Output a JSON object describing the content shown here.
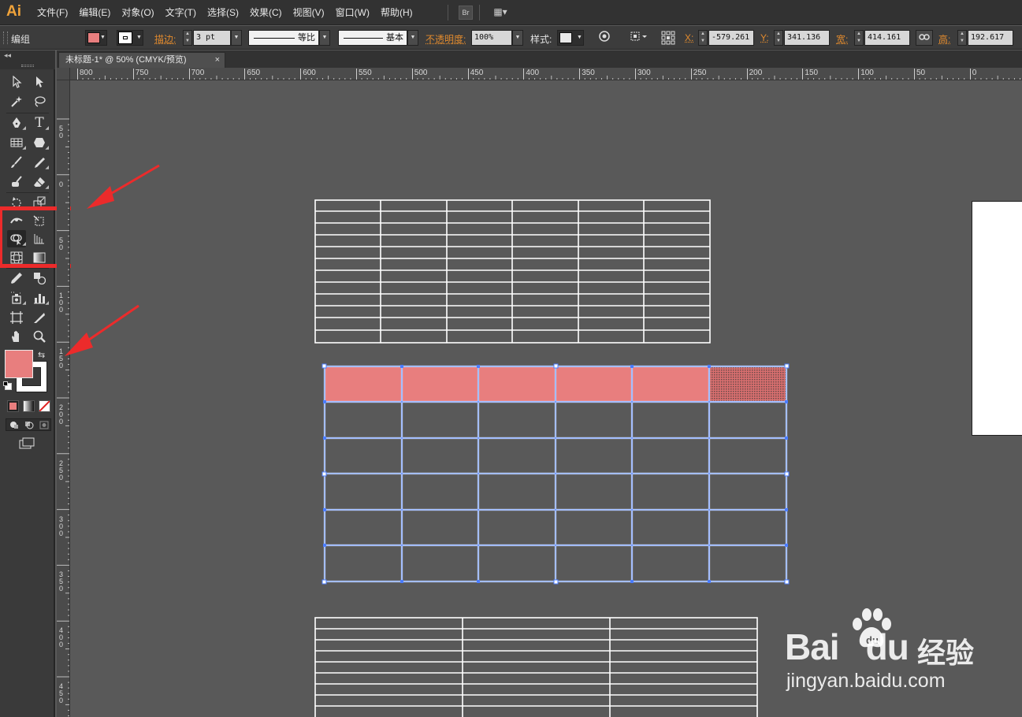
{
  "app": {
    "logo": "Ai"
  },
  "menu": [
    "文件(F)",
    "编辑(E)",
    "对象(O)",
    "文字(T)",
    "选择(S)",
    "效果(C)",
    "视图(V)",
    "窗口(W)",
    "帮助(H)"
  ],
  "menu_buttons": {
    "bridge": "Br",
    "workspace": "▦▾"
  },
  "control": {
    "selection_type": "编组",
    "fill_color": "#e87e7e",
    "stroke_label": "描边:",
    "stroke_weight": "3 pt",
    "profile_1": "等比",
    "profile_2": "基本",
    "opacity_label": "不透明度:",
    "opacity": "100%",
    "style_label": "样式:",
    "x_label": "X:",
    "x": "-579.261",
    "y_label": "Y:",
    "y": "341.136",
    "w_label": "宽:",
    "w": "414.161",
    "h_label": "高:",
    "h": "192.617"
  },
  "document": {
    "tab_title": "未标题-1* @ 50% (CMYK/预览)",
    "close": "×"
  },
  "ruler_h": [
    "800",
    "750",
    "700",
    "650",
    "600",
    "550",
    "500",
    "450",
    "400",
    "350",
    "300",
    "250",
    "200",
    "150",
    "100",
    "50",
    "0"
  ],
  "ruler_v": [
    "5\n0",
    "0",
    "5\n0",
    "1\n0\n0",
    "1\n5\n0",
    "2\n0\n0",
    "2\n5\n0",
    "3\n0\n0",
    "3\n5\n0",
    "4\n0\n0",
    "4\n5\n0"
  ],
  "tools_panel": {
    "collapse": "◂◂",
    "swap": "⇆"
  },
  "colors": {
    "fill": "#e87e7e",
    "stroke": "#ffffff",
    "table_line": "#ffffff",
    "selection": "#4a7cff",
    "highlight": "#ec2b2b"
  },
  "watermark": {
    "brand_a": "Bai",
    "brand_b": "du",
    "brand_cn": "经验",
    "url": "jingyan.baidu.com"
  }
}
